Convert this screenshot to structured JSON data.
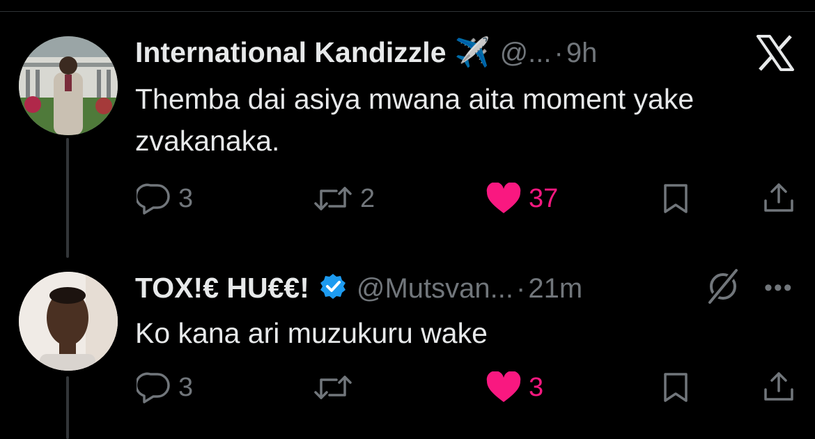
{
  "tweets": [
    {
      "name": "International Kandizzle",
      "name_emoji": "✈️",
      "handle": "@...",
      "separator": "·",
      "time": "9h",
      "text_lines": [
        "Themba dai asiya mwana aita moment yake",
        "zvakanaka."
      ],
      "replies": "3",
      "retweets": "2",
      "likes": "37",
      "liked": true,
      "icons": [
        "x-logo-icon",
        "reply-icon",
        "retweet-icon",
        "heart-icon",
        "bookmark-icon",
        "share-icon"
      ]
    },
    {
      "name": "TOX!€ HU€€!",
      "verified": true,
      "handle": "@Mutsvan...",
      "separator": "·",
      "time": "21m",
      "text": "Ko kana ari muzukuru wake",
      "replies": "3",
      "retweets": "",
      "likes": "3",
      "liked": true,
      "icons": [
        "grok-icon",
        "more-icon",
        "reply-icon",
        "retweet-icon",
        "heart-icon",
        "bookmark-icon",
        "share-icon"
      ]
    }
  ],
  "colors": {
    "background": "#000000",
    "text": "#e7e9ea",
    "muted": "#71767b",
    "like": "#f91880",
    "verified": "#1d9bf0"
  }
}
